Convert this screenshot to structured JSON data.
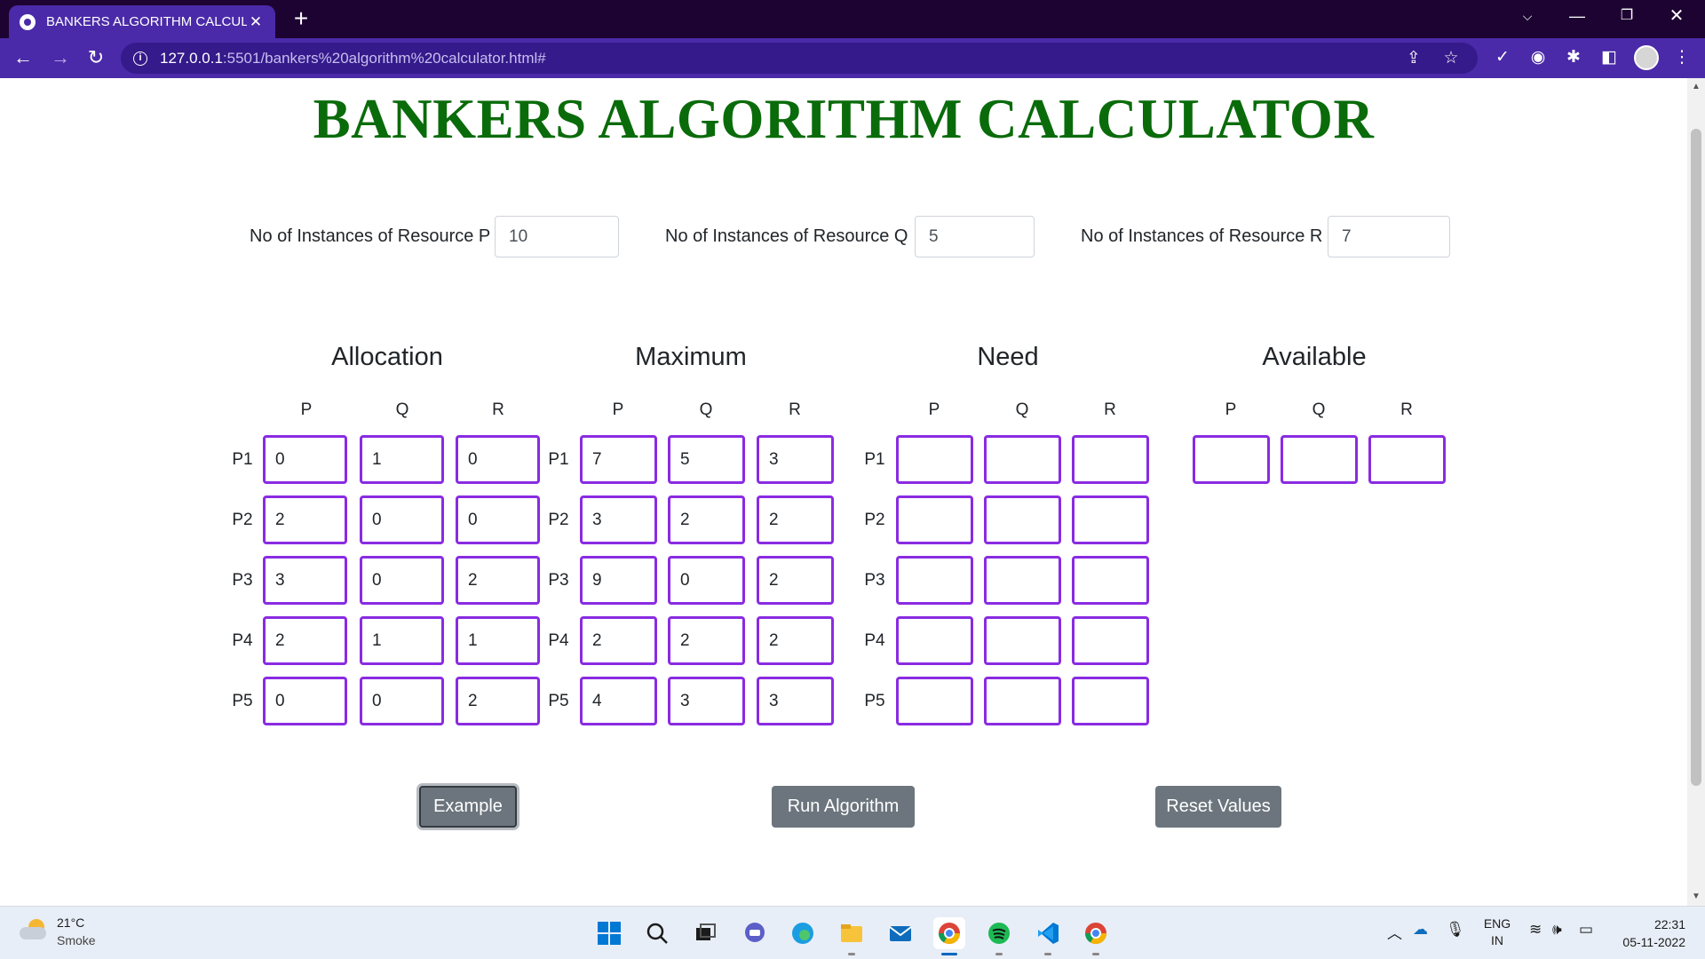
{
  "browser": {
    "tab_title": "BANKERS ALGORITHM CALCULA",
    "tab_close": "✕",
    "new_tab": "+",
    "url_host": "127.0.0.1",
    "url_path": ":5501/bankers%20algorithm%20calculator.html#"
  },
  "page": {
    "title": "BANKERS ALGORITHM CALCULATOR",
    "resources": [
      {
        "label": "No of Instances of Resource P",
        "value": "10"
      },
      {
        "label": "No of Instances of Resource Q",
        "value": "5"
      },
      {
        "label": "No of Instances of Resource R",
        "value": "7"
      }
    ],
    "sections": {
      "allocation": "Allocation",
      "maximum": "Maximum",
      "need": "Need",
      "available": "Available"
    },
    "columns": [
      "P",
      "Q",
      "R"
    ],
    "processes": [
      "P1",
      "P2",
      "P3",
      "P4",
      "P5"
    ],
    "allocation": [
      [
        "0",
        "1",
        "0"
      ],
      [
        "2",
        "0",
        "0"
      ],
      [
        "3",
        "0",
        "2"
      ],
      [
        "2",
        "1",
        "1"
      ],
      [
        "0",
        "0",
        "2"
      ]
    ],
    "maximum": [
      [
        "7",
        "5",
        "3"
      ],
      [
        "3",
        "2",
        "2"
      ],
      [
        "9",
        "0",
        "2"
      ],
      [
        "2",
        "2",
        "2"
      ],
      [
        "4",
        "3",
        "3"
      ]
    ],
    "need": [
      [
        "",
        "",
        ""
      ],
      [
        "",
        "",
        ""
      ],
      [
        "",
        "",
        ""
      ],
      [
        "",
        "",
        ""
      ],
      [
        "",
        "",
        ""
      ]
    ],
    "available": [
      "",
      "",
      ""
    ],
    "buttons": {
      "example": "Example",
      "run": "Run Algorithm",
      "reset": "Reset Values"
    }
  },
  "taskbar": {
    "weather_temp": "21°C",
    "weather_desc": "Smoke",
    "lang_line1": "ENG",
    "lang_line2": "IN",
    "time": "22:31",
    "date": "05-11-2022"
  },
  "colors": {
    "title_green": "#0a6b0a",
    "cell_border": "#8a2be2",
    "button_gray": "#6c757d",
    "chrome_purple": "#4a2aa8",
    "tabstrip_dark": "#1d0331"
  }
}
